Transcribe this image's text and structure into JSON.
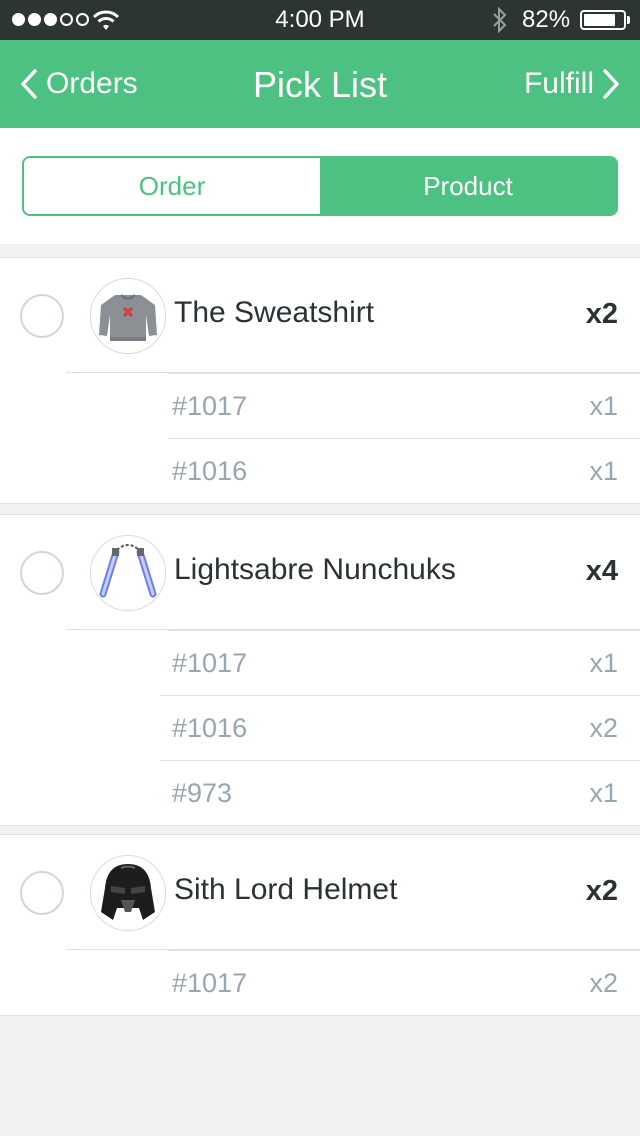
{
  "status_bar": {
    "time": "4:00 PM",
    "battery_percent": "82%",
    "battery_level": 0.82,
    "signal_bars_filled": 3,
    "signal_bars_total": 5
  },
  "nav": {
    "back_label": "Orders",
    "title": "Pick List",
    "forward_label": "Fulfill"
  },
  "segmented": {
    "options": [
      "Order",
      "Product"
    ],
    "selected": "Product"
  },
  "accent_color": "#4cc182",
  "products": [
    {
      "name": "The Sweatshirt",
      "qty": "x2",
      "icon": "sweatshirt-image",
      "orders": [
        {
          "number": "#1017",
          "qty": "x1"
        },
        {
          "number": "#1016",
          "qty": "x1"
        }
      ]
    },
    {
      "name": "Lightsabre Nunchuks",
      "qty": "x4",
      "icon": "nunchuks-image",
      "orders": [
        {
          "number": "#1017",
          "qty": "x1"
        },
        {
          "number": "#1016",
          "qty": "x2"
        },
        {
          "number": "#973",
          "qty": "x1"
        }
      ]
    },
    {
      "name": "Sith Lord Helmet",
      "qty": "x2",
      "icon": "helmet-image",
      "orders": [
        {
          "number": "#1017",
          "qty": "x2"
        }
      ]
    }
  ]
}
